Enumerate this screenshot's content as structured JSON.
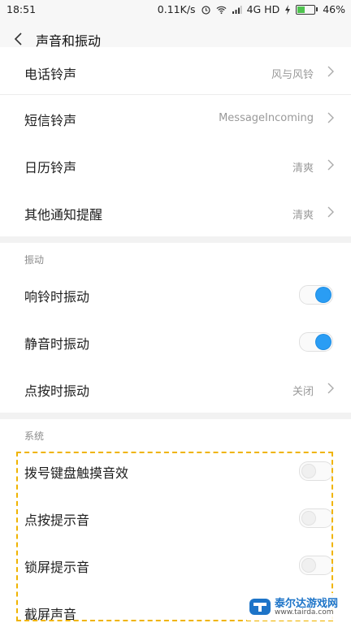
{
  "status": {
    "time": "18:51",
    "speed": "0.11K/s",
    "network": "4G HD",
    "battery": "46%",
    "battery_level": 0.46
  },
  "header": {
    "title": "声音和振动"
  },
  "ringtones": [
    {
      "label": "电话铃声",
      "value": "风与风铃"
    },
    {
      "label": "短信铃声",
      "value": "MessageIncoming"
    },
    {
      "label": "日历铃声",
      "value": "清爽"
    },
    {
      "label": "其他通知提醒",
      "value": "清爽"
    }
  ],
  "vibration": {
    "section_label": "振动",
    "ring_vibrate": {
      "label": "响铃时振动",
      "on": true
    },
    "silent_vibrate": {
      "label": "静音时振动",
      "on": true
    },
    "tap_vibrate": {
      "label": "点按时振动",
      "value": "关闭"
    }
  },
  "system": {
    "section_label": "系统",
    "dial_tone": {
      "label": "拨号键盘触摸音效",
      "on": false
    },
    "tap_sound": {
      "label": "点按提示音",
      "on": false
    },
    "lock_sound": {
      "label": "锁屏提示音",
      "on": false
    },
    "screenshot_sound": {
      "label": "截屏声音"
    }
  },
  "watermark": {
    "name": "泰尔达游戏网",
    "url": "www.tairda.com"
  },
  "colors": {
    "toggle_on": "#2a9df4",
    "highlight": "#f0b400"
  }
}
